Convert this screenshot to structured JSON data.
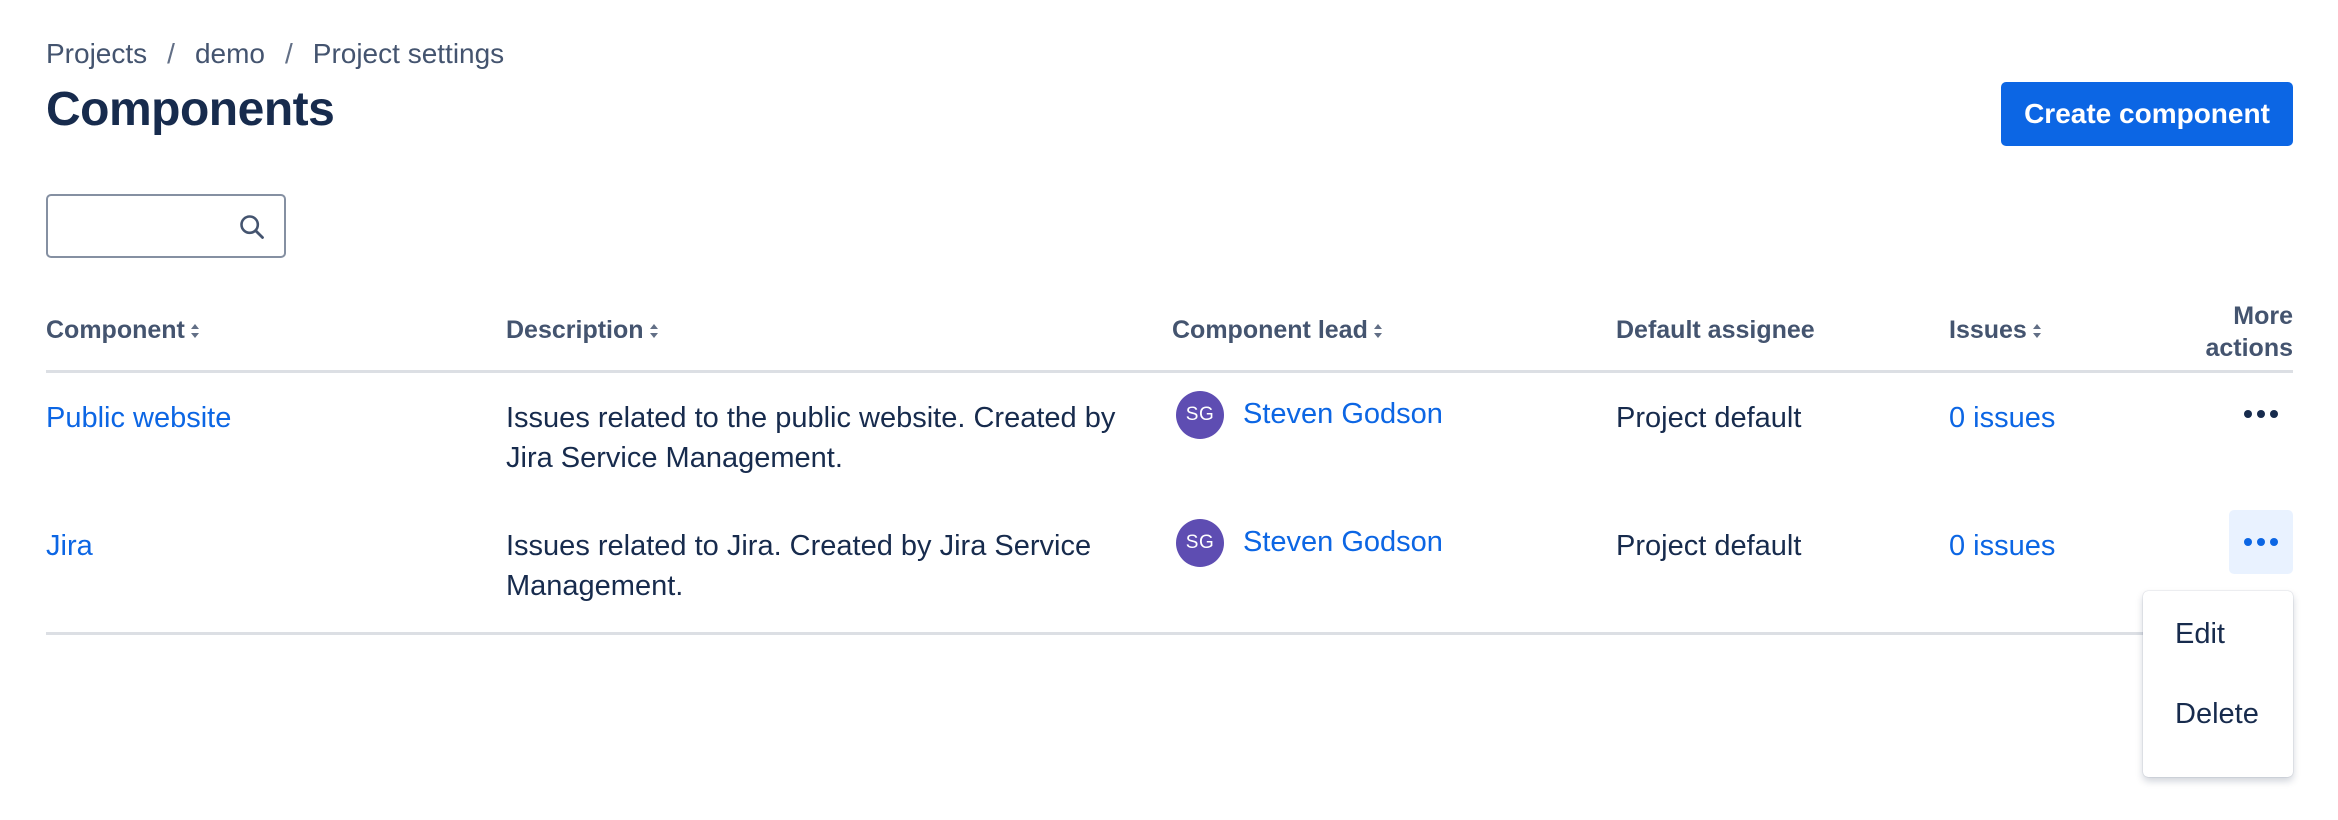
{
  "breadcrumb": {
    "items": [
      "Projects",
      "demo",
      "Project settings"
    ],
    "separator": "/"
  },
  "page_title": "Components",
  "create_button_label": "Create component",
  "search": {
    "value": "",
    "placeholder": ""
  },
  "table": {
    "headers": {
      "component": "Component",
      "description": "Description",
      "lead": "Component lead",
      "assignee": "Default assignee",
      "issues": "Issues",
      "more_line1": "More",
      "more_line2": "actions"
    },
    "rows": [
      {
        "component": "Public website",
        "description": "Issues related to the public website. Created by Jira Service Management.",
        "lead_initials": "SG",
        "lead_name": "Steven Godson",
        "assignee": "Project default",
        "issues": "0 issues"
      },
      {
        "component": "Jira",
        "description": "Issues related to Jira. Created by Jira Service Management.",
        "lead_initials": "SG",
        "lead_name": "Steven Godson",
        "assignee": "Project default",
        "issues": "0 issues"
      }
    ]
  },
  "actions_menu": {
    "items": [
      "Edit",
      "Delete"
    ]
  },
  "icons": {
    "search": "search-icon",
    "sort": "sort-icon",
    "more": "more-dots-icon"
  },
  "colors": {
    "brand_blue": "#0c66e4",
    "avatar_purple": "#5e4db2",
    "text_dark": "#172b4d",
    "text_subtle": "#44546f"
  }
}
